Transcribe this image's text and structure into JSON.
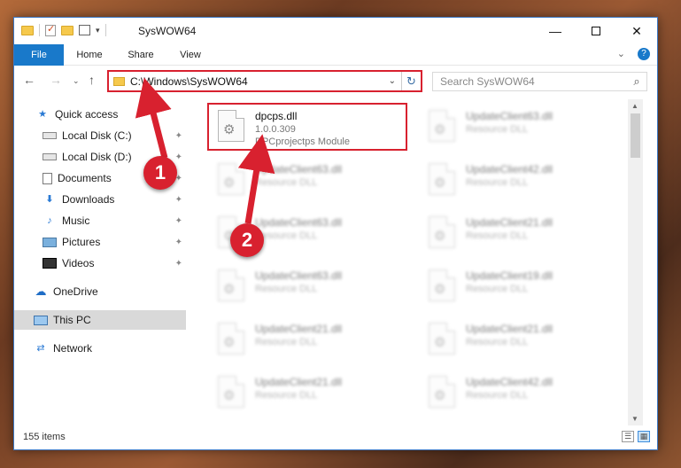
{
  "window": {
    "title": "SysWOW64",
    "controls": {
      "minimize": "—",
      "maximize": "",
      "close": "✕"
    }
  },
  "ribbon": {
    "tabs": [
      "File",
      "Home",
      "Share",
      "View"
    ],
    "expand_icon": "⌄",
    "help": "?"
  },
  "navigation": {
    "back": "←",
    "forward": "→",
    "recent": "⌄",
    "up": "↑",
    "address": "C:\\Windows\\SysWOW64",
    "address_dropdown": "⌄",
    "refresh": "↻",
    "search_placeholder": "Search SysWOW64",
    "search_icon": "⌕"
  },
  "sidebar": {
    "items": [
      {
        "label": "Quick access",
        "icon": "star-icon",
        "glyph": "★",
        "pinned": false
      },
      {
        "label": "Local Disk (C:)",
        "icon": "disk-icon",
        "glyph": "",
        "pinned": true
      },
      {
        "label": "Local Disk (D:)",
        "icon": "disk-icon",
        "glyph": "",
        "pinned": true
      },
      {
        "label": "Documents",
        "icon": "document-icon",
        "glyph": "",
        "pinned": true
      },
      {
        "label": "Downloads",
        "icon": "download-icon",
        "glyph": "⬇",
        "pinned": true
      },
      {
        "label": "Music",
        "icon": "music-icon",
        "glyph": "♪",
        "pinned": true
      },
      {
        "label": "Pictures",
        "icon": "picture-icon",
        "glyph": "",
        "pinned": true
      },
      {
        "label": "Videos",
        "icon": "video-icon",
        "glyph": "",
        "pinned": true
      },
      {
        "label": "OneDrive",
        "icon": "cloud-icon",
        "glyph": "☁",
        "pinned": false
      },
      {
        "label": "This PC",
        "icon": "computer-icon",
        "glyph": "",
        "pinned": false,
        "selected": true
      },
      {
        "label": "Network",
        "icon": "network-icon",
        "glyph": "⇄",
        "pinned": false
      }
    ],
    "pin_glyph": "📌"
  },
  "files": [
    {
      "name": "dpcps.dll",
      "line1": "1.0.0.309",
      "line2": "DPCprojectps Module",
      "highlighted": true,
      "blurred": false
    },
    {
      "name": "UpdateClient63.dll",
      "line1": "Resource DLL",
      "line2": "",
      "highlighted": false,
      "blurred": true
    },
    {
      "name": "UpdateClient63.dll",
      "line1": "Resource DLL",
      "line2": "",
      "highlighted": false,
      "blurred": true
    },
    {
      "name": "UpdateClient42.dll",
      "line1": "Resource DLL",
      "line2": "",
      "highlighted": false,
      "blurred": true
    },
    {
      "name": "UpdateClient63.dll",
      "line1": "Resource DLL",
      "line2": "",
      "highlighted": false,
      "blurred": true
    },
    {
      "name": "UpdateClient21.dll",
      "line1": "Resource DLL",
      "line2": "",
      "highlighted": false,
      "blurred": true
    },
    {
      "name": "UpdateClient63.dll",
      "line1": "Resource DLL",
      "line2": "",
      "highlighted": false,
      "blurred": true
    },
    {
      "name": "UpdateClient19.dll",
      "line1": "Resource DLL",
      "line2": "",
      "highlighted": false,
      "blurred": true
    },
    {
      "name": "UpdateClient21.dll",
      "line1": "Resource DLL",
      "line2": "",
      "highlighted": false,
      "blurred": true
    },
    {
      "name": "UpdateClient21.dll",
      "line1": "Resource DLL",
      "line2": "",
      "highlighted": false,
      "blurred": true
    },
    {
      "name": "UpdateClient21.dll",
      "line1": "Resource DLL",
      "line2": "",
      "highlighted": false,
      "blurred": true
    },
    {
      "name": "UpdateClient42.dll",
      "line1": "Resource DLL",
      "line2": "",
      "highlighted": false,
      "blurred": true
    }
  ],
  "status": {
    "item_count": "155 items"
  },
  "annotations": {
    "badge_1": "1",
    "badge_2": "2",
    "color": "#d8212f"
  }
}
